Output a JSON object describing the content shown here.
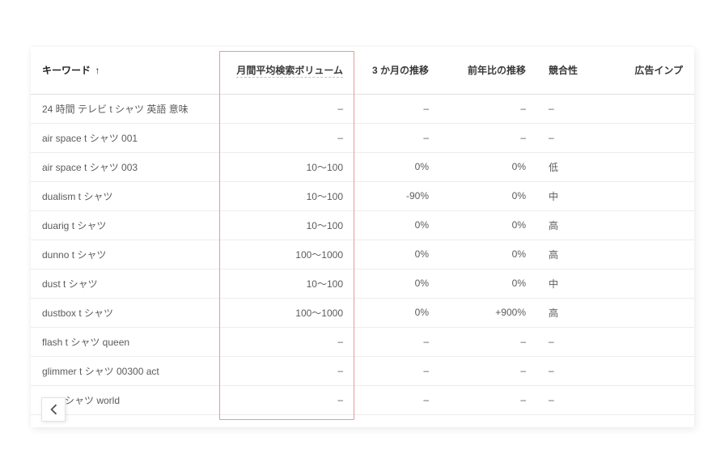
{
  "headers": {
    "keyword": "キーワード",
    "sort_indicator": "↑",
    "volume": "月間平均検索ボリューム",
    "three_month": "3 か月の推移",
    "yoy": "前年比の推移",
    "competition": "競合性",
    "ad_imp": "広告インプ"
  },
  "rows": [
    {
      "keyword": "24 時間 テレビ t シャツ 英語 意味",
      "volume": "–",
      "three_month": "–",
      "yoy": "–",
      "competition": "–",
      "ad_imp": ""
    },
    {
      "keyword": "air space t シャツ 001",
      "volume": "–",
      "three_month": "–",
      "yoy": "–",
      "competition": "–",
      "ad_imp": ""
    },
    {
      "keyword": "air space t シャツ 003",
      "volume": "10～100",
      "three_month": "0%",
      "yoy": "0%",
      "competition": "低",
      "ad_imp": ""
    },
    {
      "keyword": "dualism t シャツ",
      "volume": "10～100",
      "three_month": "-90%",
      "yoy": "0%",
      "competition": "中",
      "ad_imp": ""
    },
    {
      "keyword": "duarig t シャツ",
      "volume": "10～100",
      "three_month": "0%",
      "yoy": "0%",
      "competition": "高",
      "ad_imp": ""
    },
    {
      "keyword": "dunno t シャツ",
      "volume": "100～1000",
      "three_month": "0%",
      "yoy": "0%",
      "competition": "高",
      "ad_imp": ""
    },
    {
      "keyword": "dust t シャツ",
      "volume": "10～100",
      "three_month": "0%",
      "yoy": "0%",
      "competition": "中",
      "ad_imp": ""
    },
    {
      "keyword": "dustbox t シャツ",
      "volume": "100～1000",
      "three_month": "0%",
      "yoy": "+900%",
      "competition": "高",
      "ad_imp": ""
    },
    {
      "keyword": "flash t シャツ queen",
      "volume": "–",
      "three_month": "–",
      "yoy": "–",
      "competition": "–",
      "ad_imp": ""
    },
    {
      "keyword": "glimmer t シャツ 00300 act",
      "volume": "–",
      "three_month": "–",
      "yoy": "–",
      "competition": "–",
      "ad_imp": ""
    },
    {
      "keyword": "ssy t シャツ world",
      "volume": "–",
      "three_month": "–",
      "yoy": "–",
      "competition": "–",
      "ad_imp": ""
    }
  ],
  "highlight_color": "#e79a9c"
}
